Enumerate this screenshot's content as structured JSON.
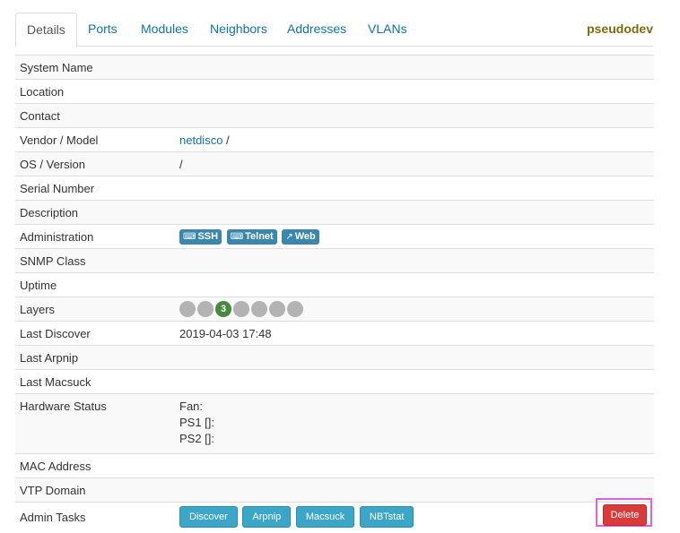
{
  "tabs": [
    "Details",
    "Ports",
    "Modules",
    "Neighbors",
    "Addresses",
    "VLANs"
  ],
  "device_name": "pseudodev",
  "rows": {
    "system_name": {
      "label": "System Name",
      "value": ""
    },
    "location": {
      "label": "Location",
      "value": ""
    },
    "contact": {
      "label": "Contact",
      "value": ""
    },
    "vendor_model": {
      "label": "Vendor / Model",
      "vendor": "netdisco",
      "separator": " /"
    },
    "os_version": {
      "label": "OS / Version",
      "value": "/"
    },
    "serial_number": {
      "label": "Serial Number",
      "value": ""
    },
    "description": {
      "label": "Description",
      "value": ""
    },
    "administration": {
      "label": "Administration",
      "buttons": [
        "SSH",
        "Telnet",
        "Web"
      ]
    },
    "snmp_class": {
      "label": "SNMP Class",
      "value": ""
    },
    "uptime": {
      "label": "Uptime",
      "value": ""
    },
    "layers": {
      "label": "Layers",
      "active_layer": "3"
    },
    "last_discover": {
      "label": "Last Discover",
      "value": "2019-04-03 17:48"
    },
    "last_arpnip": {
      "label": "Last Arpnip",
      "value": ""
    },
    "last_macsuck": {
      "label": "Last Macsuck",
      "value": ""
    },
    "hardware_status": {
      "label": "Hardware Status",
      "lines": [
        "Fan:",
        "PS1 []:",
        "PS2 []:"
      ]
    },
    "mac_address": {
      "label": "MAC Address",
      "value": ""
    },
    "vtp_domain": {
      "label": "VTP Domain",
      "value": ""
    },
    "admin_tasks": {
      "label": "Admin Tasks",
      "buttons": [
        "Discover",
        "Arpnip",
        "Macsuck",
        "NBTstat"
      ],
      "delete": "Delete"
    }
  },
  "icons": {
    "ssh": "keyboard-icon",
    "telnet": "keyboard-icon",
    "web": "external-link-icon"
  },
  "colors": {
    "link": "#0f74a8",
    "badge": "#3a87ad",
    "layer_active": "#46883d",
    "layer_inactive": "#b3b3b3",
    "task_button": "#3ba6c8",
    "delete_button": "#d93b3b",
    "highlight": "#e060e0",
    "device_name": "#7c6a11"
  }
}
